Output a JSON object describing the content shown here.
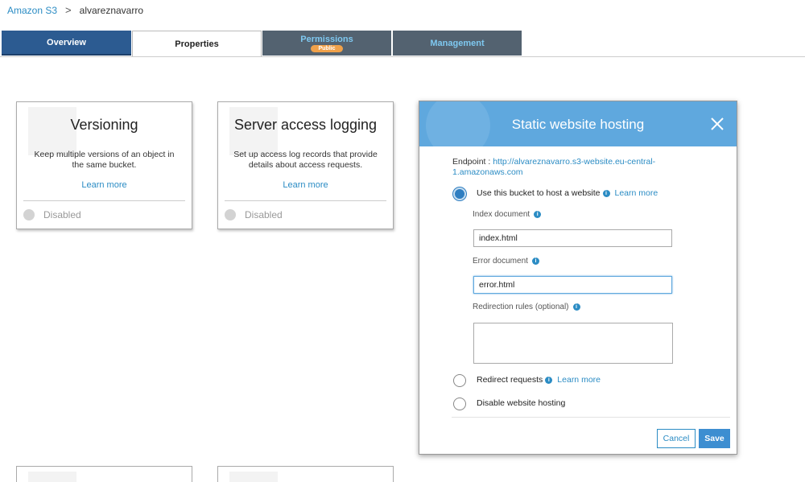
{
  "breadcrumb": {
    "root": "Amazon S3",
    "separator": ">",
    "current": "alvareznavarro"
  },
  "tabs": {
    "overview": "Overview",
    "properties": "Properties",
    "permissions": "Permissions",
    "permissions_badge": "Public",
    "management": "Management"
  },
  "cards": {
    "versioning": {
      "title": "Versioning",
      "description": "Keep multiple versions of an object in the same bucket.",
      "link": "Learn more",
      "status": "Disabled"
    },
    "logging": {
      "title": "Server access logging",
      "description": "Set up access log records that provide details about access requests.",
      "link": "Learn more",
      "status": "Disabled"
    }
  },
  "modal": {
    "title": "Static website hosting",
    "endpoint_label": "Endpoint :",
    "endpoint_url": "http://alvareznavarro.s3-website.eu-central-1.amazonaws.com",
    "option_host": "Use this bucket to host a website",
    "option_host_link": "Learn more",
    "index_label": "Index document",
    "index_value": "index.html",
    "error_label": "Error document",
    "error_value": "error.html",
    "redirection_label": "Redirection rules (optional)",
    "option_redirect": "Redirect requests",
    "option_redirect_link": "Learn more",
    "option_disable": "Disable website hosting",
    "cancel": "Cancel",
    "save": "Save"
  },
  "colors": {
    "accent": "#2b8cc4",
    "header_blue": "#5fa8de",
    "tab_active_dark": "#2c5b91",
    "tab_gray": "#536270",
    "badge_orange": "#f0a14a"
  }
}
